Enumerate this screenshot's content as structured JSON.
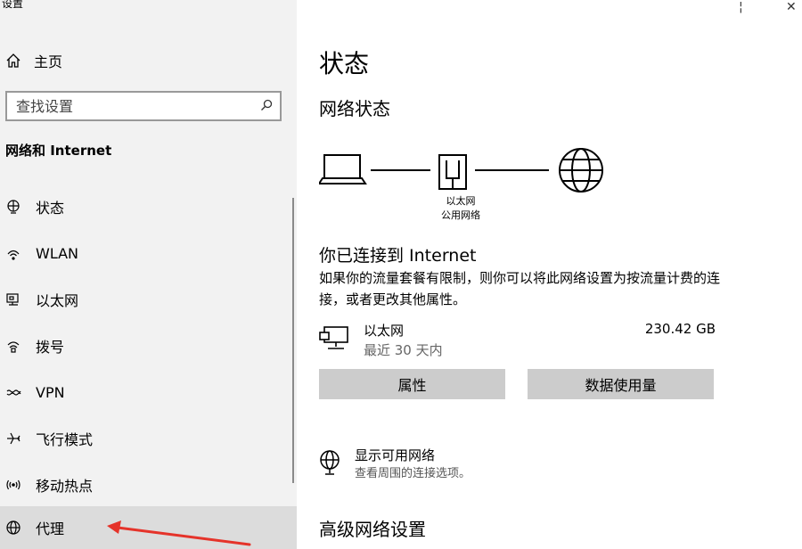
{
  "window": {
    "title": "设置"
  },
  "sidebar": {
    "home_label": "主页",
    "search_placeholder": "查找设置",
    "section_title": "网络和 Internet",
    "items": [
      {
        "label": "状态",
        "icon": "status-globe-icon",
        "active": false
      },
      {
        "label": "WLAN",
        "icon": "wifi-icon",
        "active": false
      },
      {
        "label": "以太网",
        "icon": "ethernet-icon",
        "active": false
      },
      {
        "label": "拨号",
        "icon": "dialup-icon",
        "active": false
      },
      {
        "label": "VPN",
        "icon": "vpn-icon",
        "active": false
      },
      {
        "label": "飞行模式",
        "icon": "airplane-icon",
        "active": false
      },
      {
        "label": "移动热点",
        "icon": "hotspot-icon",
        "active": false
      },
      {
        "label": "代理",
        "icon": "globe-icon",
        "active": true
      }
    ]
  },
  "main": {
    "page_title": "状态",
    "network_status_heading": "网络状态",
    "diagram": {
      "adapter_name": "以太网",
      "network_type": "公用网络"
    },
    "connection_title": "你已连接到 Internet",
    "connection_description": "如果你的流量套餐有限制，则你可以将此网络设置为按流量计费的连接，或者更改其他属性。",
    "ethernet": {
      "name": "以太网",
      "period": "最近 30 天内",
      "usage": "230.42 GB"
    },
    "buttons": {
      "properties": "属性",
      "data_usage": "数据使用量"
    },
    "available_networks": {
      "title": "显示可用网络",
      "description": "查看周围的连接选项。"
    },
    "advanced_heading": "高级网络设置"
  },
  "colors": {
    "sidebar_bg": "#f2f2f2",
    "selected_bg": "#dcdcdc",
    "button_bg": "#cccccc",
    "annotation_arrow": "#e5332a"
  }
}
